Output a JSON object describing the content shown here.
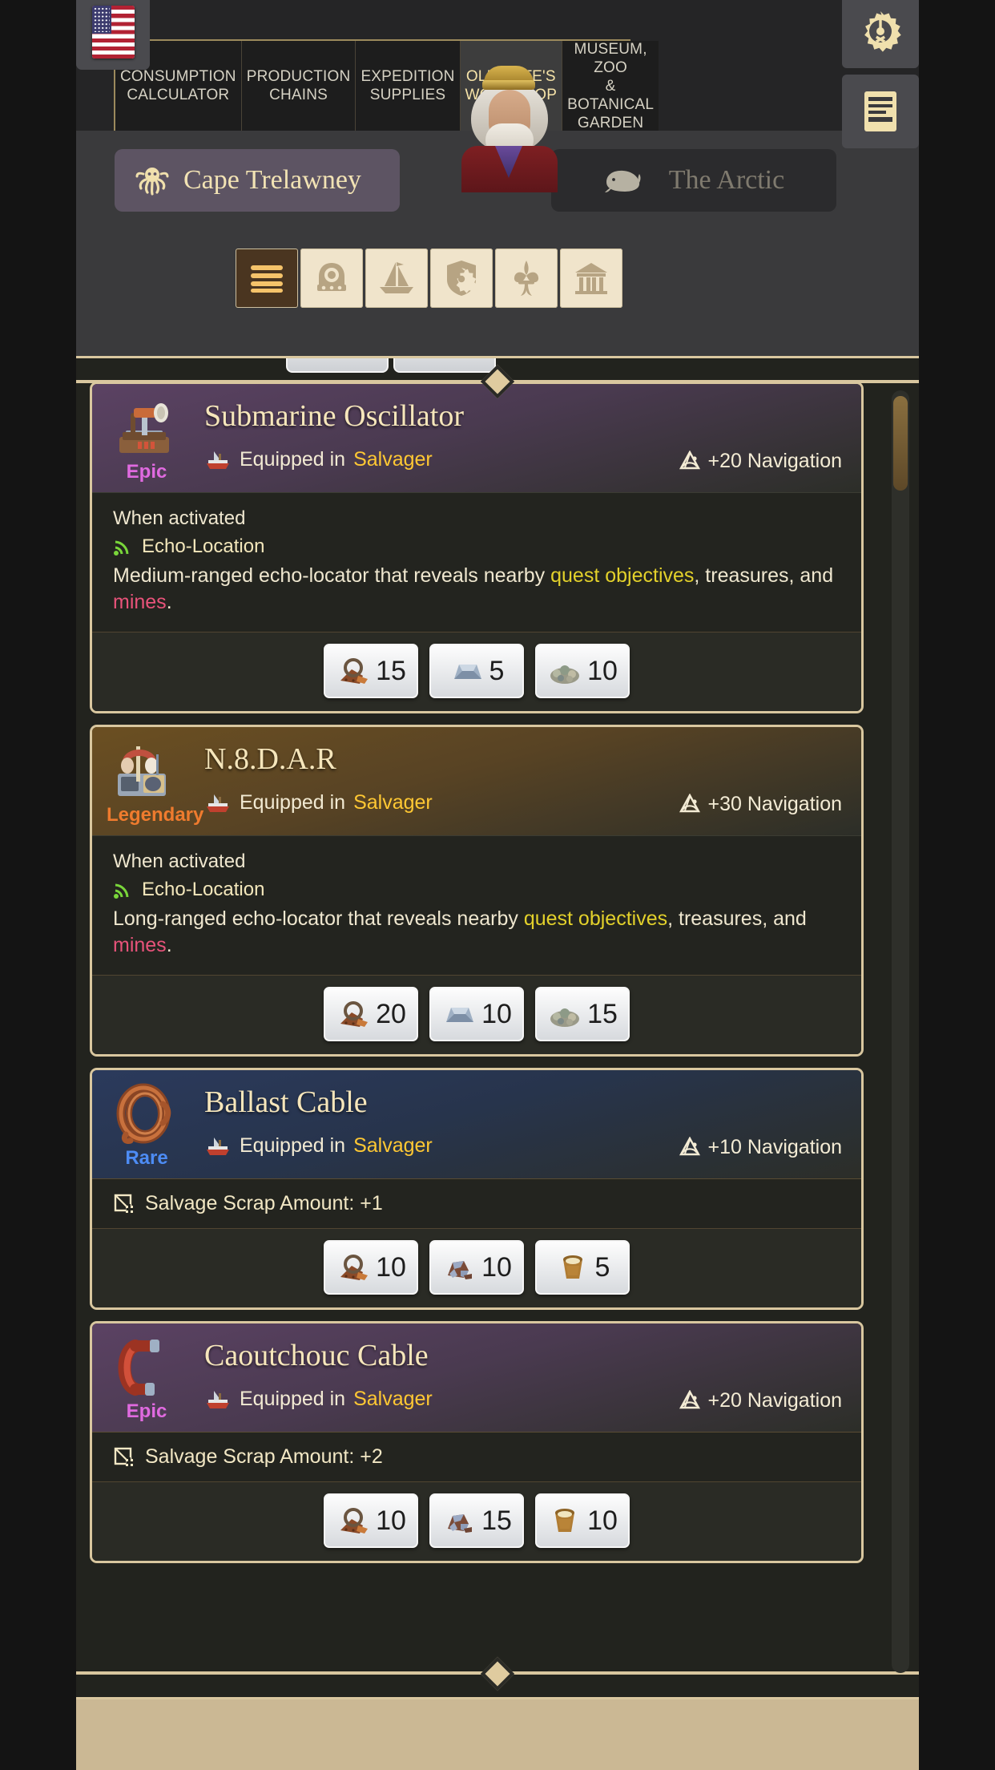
{
  "header": {
    "flag_icon": "us-flag-icon",
    "tabs": [
      {
        "line1": "CONSUMPTION",
        "line2": "CALCULATOR",
        "active": false
      },
      {
        "line1": "PRODUCTION",
        "line2": "CHAINS",
        "active": false
      },
      {
        "line1": "EXPEDITION",
        "line2": "SUPPLIES",
        "active": false
      },
      {
        "line1": "OLD NATE'S",
        "line2": "WORKSHOP",
        "active": true
      },
      {
        "line1": "MUSEUM, ZOO",
        "line2": "& BOTANICAL",
        "line3": "GARDEN",
        "active": false
      }
    ],
    "gear_icon": "gear-icon",
    "book_icon": "ledger-icon"
  },
  "regions": [
    {
      "label": "Cape Trelawney",
      "icon": "octopus-icon",
      "selected": true
    },
    {
      "label": "The Arctic",
      "icon": "whale-icon",
      "selected": false
    }
  ],
  "categories": [
    {
      "icon": "hamburger-all-icon",
      "active": true
    },
    {
      "icon": "diving-helmet-icon",
      "active": false
    },
    {
      "icon": "sailing-ship-icon",
      "active": false
    },
    {
      "icon": "shield-gear-icon",
      "active": false
    },
    {
      "icon": "fleur-de-lis-icon",
      "active": false
    },
    {
      "icon": "building-icon",
      "active": false
    }
  ],
  "colors": {
    "accent_gold": "#d9c79f",
    "epic": "#e06ae0",
    "legendary": "#ef7b2e",
    "rare": "#4d8cf5",
    "ship_name": "#ffc833",
    "quest": "#e3d12b",
    "mines": "#e8537a",
    "effect_green": "#79d63a"
  },
  "items": [
    {
      "name": "Submarine Oscillator",
      "rarity": "Epic",
      "rarity_class": "epic",
      "icon": "submarine-oscillator-icon",
      "equipped_label": "Equipped in",
      "equipped_ship": "Salvager",
      "bonus": "+20 Navigation",
      "bonus_icon": "sextant-icon",
      "activation_label": "When activated",
      "effect_name": "Echo-Location",
      "effect_icon": "echo-location-icon",
      "desc_pre": "Medium-ranged echo-locator that reveals nearby ",
      "desc_quest": "quest objectives",
      "desc_mid": ", treasures, and ",
      "desc_mines": "mines",
      "desc_post": ".",
      "costs": [
        {
          "icon": "scrap-icon",
          "amount": "15"
        },
        {
          "icon": "steel-ingot-icon",
          "amount": "5"
        },
        {
          "icon": "gravel-icon",
          "amount": "10"
        }
      ]
    },
    {
      "name": "N.8.D.A.R",
      "rarity": "Legendary",
      "rarity_class": "legendary",
      "icon": "nedar-sonar-icon",
      "equipped_label": "Equipped in",
      "equipped_ship": "Salvager",
      "bonus": "+30 Navigation",
      "bonus_icon": "sextant-icon",
      "activation_label": "When activated",
      "effect_name": "Echo-Location",
      "effect_icon": "echo-location-icon",
      "desc_pre": "Long-ranged echo-locator that reveals nearby ",
      "desc_quest": "quest objectives",
      "desc_mid": ", treasures, and ",
      "desc_mines": "mines",
      "desc_post": ".",
      "costs": [
        {
          "icon": "scrap-icon",
          "amount": "20"
        },
        {
          "icon": "steel-ingot-icon",
          "amount": "10"
        },
        {
          "icon": "gravel-icon",
          "amount": "15"
        }
      ]
    },
    {
      "name": "Ballast Cable",
      "rarity": "Rare",
      "rarity_class": "rare",
      "icon": "copper-cable-coil-icon",
      "equipped_label": "Equipped in",
      "equipped_ship": "Salvager",
      "bonus": "+10 Navigation",
      "bonus_icon": "sextant-icon",
      "buff_icon": "salvage-crate-icon",
      "buff_text": "Salvage Scrap Amount: +1",
      "costs": [
        {
          "icon": "scrap-icon",
          "amount": "10"
        },
        {
          "icon": "ore-icon",
          "amount": "10"
        },
        {
          "icon": "clay-bucket-icon",
          "amount": "5"
        }
      ]
    },
    {
      "name": "Caoutchouc Cable",
      "rarity": "Epic",
      "rarity_class": "epic",
      "icon": "rubber-cable-icon",
      "equipped_label": "Equipped in",
      "equipped_ship": "Salvager",
      "bonus": "+20 Navigation",
      "bonus_icon": "sextant-icon",
      "buff_icon": "salvage-crate-icon",
      "buff_text": "Salvage Scrap Amount: +2",
      "costs": [
        {
          "icon": "scrap-icon",
          "amount": "10"
        },
        {
          "icon": "ore-icon",
          "amount": "15"
        },
        {
          "icon": "clay-bucket-icon",
          "amount": "10"
        }
      ]
    }
  ]
}
